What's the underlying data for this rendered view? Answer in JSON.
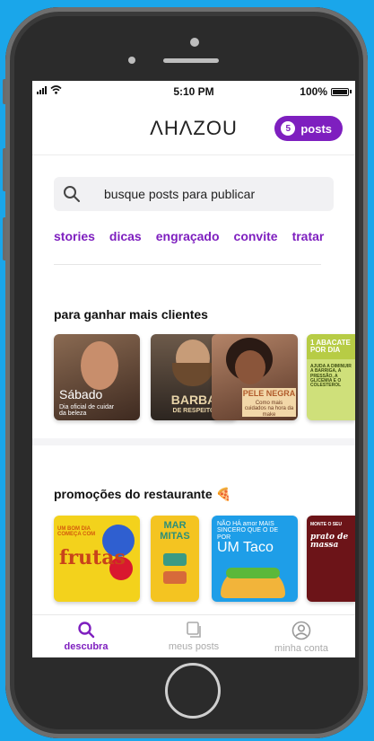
{
  "status_bar": {
    "time": "5:10 PM",
    "battery": "100%"
  },
  "header": {
    "logo": "ΛHΛZOU",
    "posts_count": "5",
    "posts_label": "posts"
  },
  "search": {
    "placeholder": "busque posts para publicar"
  },
  "chips": [
    "stories",
    "dicas",
    "engraçado",
    "convite",
    "tratar"
  ],
  "sections": [
    {
      "title": "para ganhar mais clientes",
      "cards": [
        {
          "title": "Sábado",
          "subtitle": "Dia oficial de cuidar da beleza",
          "color": "#6b4c3b"
        },
        {
          "title": "BARBA",
          "subtitle": "DE RESPEITO",
          "color": "#4a3a30"
        },
        {
          "title": "PELE NEGRA",
          "subtitle": "Como mais cuidados na hora da make",
          "color": "#7a4f3a"
        },
        {
          "title": "1 ABACATE POR DIA",
          "subtitle": "AJUDA A DIMINUIR A BARRIGA, A PRESSÃO, A GLICEMIA E O COLESTEROL",
          "color": "#bcd24a"
        }
      ]
    },
    {
      "title": "promoções do restaurante 🍕",
      "cards": [
        {
          "title": "frutas",
          "subtitle": "UM BOM DIA COMEÇA COM",
          "color": "#f3d21c"
        },
        {
          "title": "MAR MITAS",
          "subtitle": "",
          "color": "#f4c421"
        },
        {
          "title": "UM Taco",
          "subtitle": "NÃO HÁ amor MAIS SINCERO QUE O DE POR",
          "color": "#1e9ee8"
        },
        {
          "title": "prato de massa",
          "subtitle": "MONTE O SEU",
          "color": "#6c1418"
        }
      ]
    }
  ],
  "tabs": [
    {
      "label": "descubra",
      "icon": "search-icon",
      "active": true
    },
    {
      "label": "meus posts",
      "icon": "posts-icon",
      "active": false
    },
    {
      "label": "minha conta",
      "icon": "account-icon",
      "active": false
    }
  ],
  "colors": {
    "brand": "#7e1fbf",
    "background": "#1aa6ea"
  }
}
